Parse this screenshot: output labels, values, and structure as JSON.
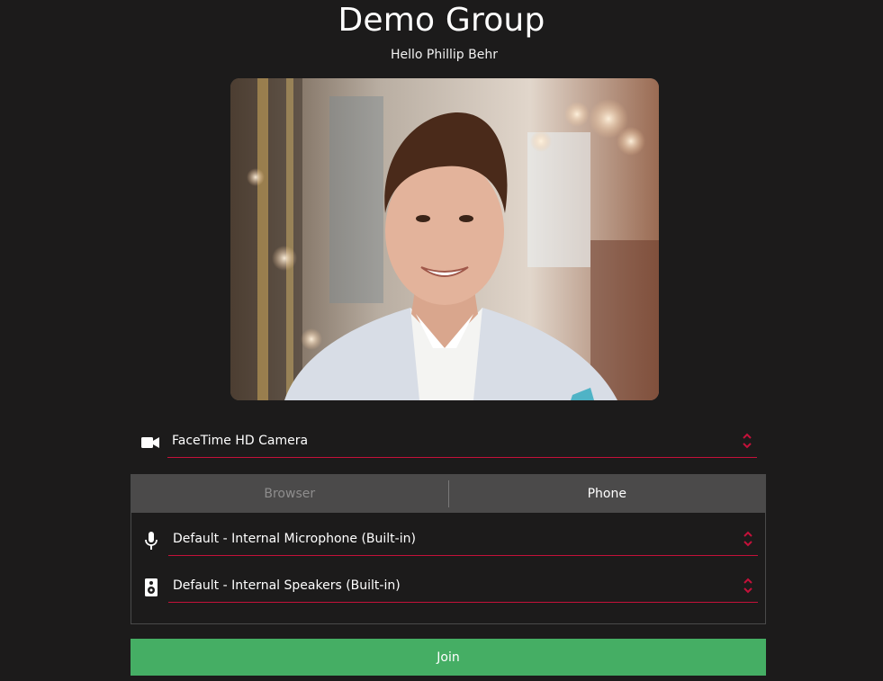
{
  "header": {
    "title": "Demo Group",
    "greeting": "Hello Phillip Behr"
  },
  "video_preview": {
    "description_icon": "camera-preview"
  },
  "camera": {
    "icon": "video-camera-icon",
    "selected": "FaceTime HD Camera"
  },
  "audio": {
    "tabs": [
      {
        "label": "Browser",
        "active": false
      },
      {
        "label": "Phone",
        "active": true
      }
    ],
    "microphone": {
      "icon": "microphone-icon",
      "selected": "Default - Internal Microphone (Built-in)"
    },
    "speakers": {
      "icon": "speaker-icon",
      "selected": "Default - Internal Speakers (Built-in)"
    }
  },
  "join": {
    "label": "Join"
  },
  "colors": {
    "background": "#1c1b1b",
    "accent_underline": "#c4113a",
    "join_green": "#45ae64",
    "tab_bar": "#4b4a4a"
  }
}
